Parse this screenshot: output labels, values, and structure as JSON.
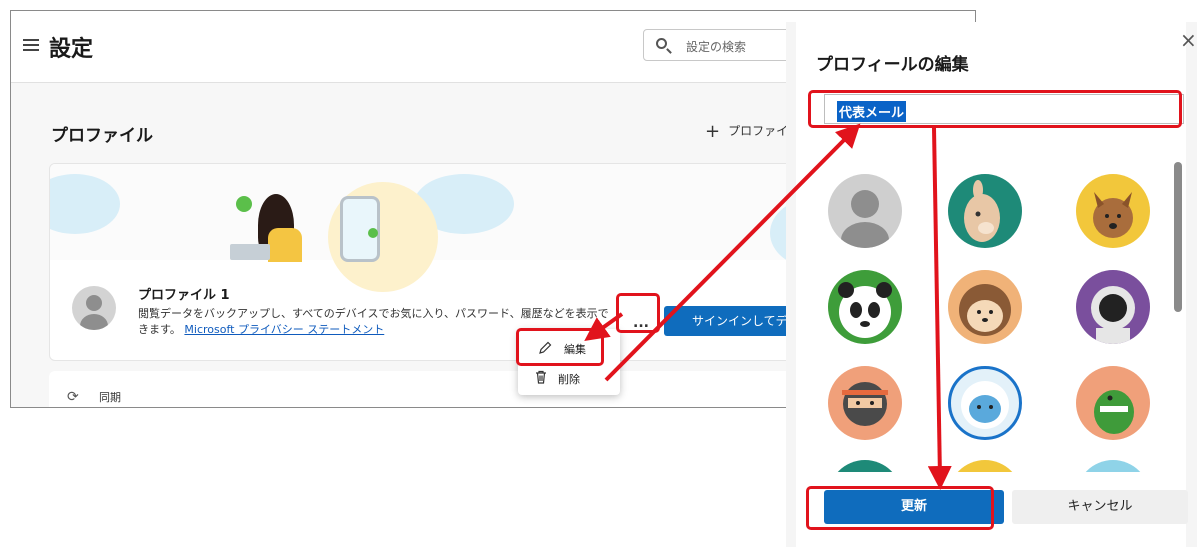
{
  "settings": {
    "title": "設定",
    "search_placeholder": "設定の検索",
    "section_title": "プロファイル",
    "add_profile_label": "プロファイル",
    "profile": {
      "name": "プロファイル 1",
      "description": "閲覧データをバックアップし、すべてのデバイスでお気に入り、パスワード、履歴などを表示で",
      "description2": "きます。",
      "privacy_link": "Microsoft プライバシー ステートメント"
    },
    "more_label": "...",
    "signin_label": "サインインしてデータを同",
    "menu": {
      "edit_label": "編集",
      "delete_label": "削除"
    },
    "sync_label": "同期"
  },
  "dialog": {
    "title": "プロフィールの編集",
    "close_label": "×",
    "name_value": "代表メール",
    "update_label": "更新",
    "cancel_label": "キャンセル"
  },
  "colors": {
    "accent": "#0f6cbd",
    "highlight": "#e1131c"
  }
}
